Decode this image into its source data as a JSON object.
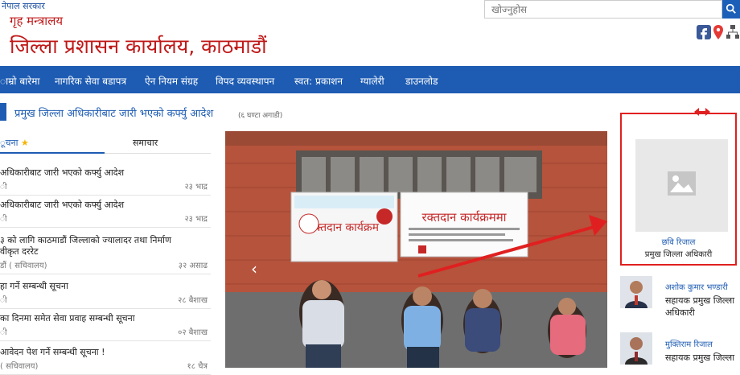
{
  "header": {
    "gov": "नेपाल सरकार",
    "ministry": "गृह मन्त्रालय",
    "office": "जिल्ला प्रशासन कार्यालय, काठमाडौं",
    "search_placeholder": "खोज्नुहोस"
  },
  "nav": {
    "items": [
      "ाम्रो बारेमा",
      "नागरिक सेवा बडापत्र",
      "ऐन नियम संग्रह",
      "विपद व्यवस्थापन",
      "स्वत: प्रकाशन",
      "ग्यालेरी",
      "डाउनलोड"
    ]
  },
  "ticker": {
    "text": "प्रमुख जिल्ला अधिकारीबाट जारी भएको कर्फ्यु आदेश",
    "time": "(६ घण्टा अगाडी)"
  },
  "tabs": {
    "first": "ूचना",
    "second": "समाचार"
  },
  "news": [
    {
      "title": "अधिकारीबाट जारी भएको कर्फ्यु आदेश",
      "meta": "ी",
      "date": "२३ भाद्र"
    },
    {
      "title": "अधिकारीबाट जारी भएको कर्फ्यु आदेश",
      "meta": "ी",
      "date": "२३ भाद्र"
    },
    {
      "title": "३ को लागि काठमाडौं जिल्लाको ज्यालादर तथा निर्माण",
      "title2": "वीकृत दररेट",
      "meta": "डौं ( सचिवालय)",
      "date": "३२ असाढ"
    },
    {
      "title": "हा गर्ने सम्बन्धी सूचना",
      "meta": "ी",
      "date": "२८ बैशाख"
    },
    {
      "title": "का दिनमा समेत सेवा प्रवाह सम्बन्धी सूचना",
      "meta": "ी",
      "date": "०२ बैशाख"
    },
    {
      "title": "आवेदन पेश गर्ने सम्बन्धी सूचना !",
      "meta": "( सचिवालय)",
      "date": "१८ चैत्र"
    }
  ],
  "banner": {
    "left": "रक्तदान कार्यक्रम",
    "right": "रक्तदान कार्यक्रममा"
  },
  "cdo": {
    "name": "छवि रिजाल",
    "post": "प्रमुख जिल्ला अधिकारी"
  },
  "staff": [
    {
      "name": "अशोक कुमार भण्डारी",
      "post": "सहायक प्रमुख जिल्ला अधिकारी"
    },
    {
      "name": "मुक्तिराम रिजाल",
      "post": "सहायक प्रमुख जिल्ला"
    }
  ],
  "colors": {
    "nav": "#1e5cb3",
    "office_title": "#c01818",
    "highlight": "#e02020"
  }
}
